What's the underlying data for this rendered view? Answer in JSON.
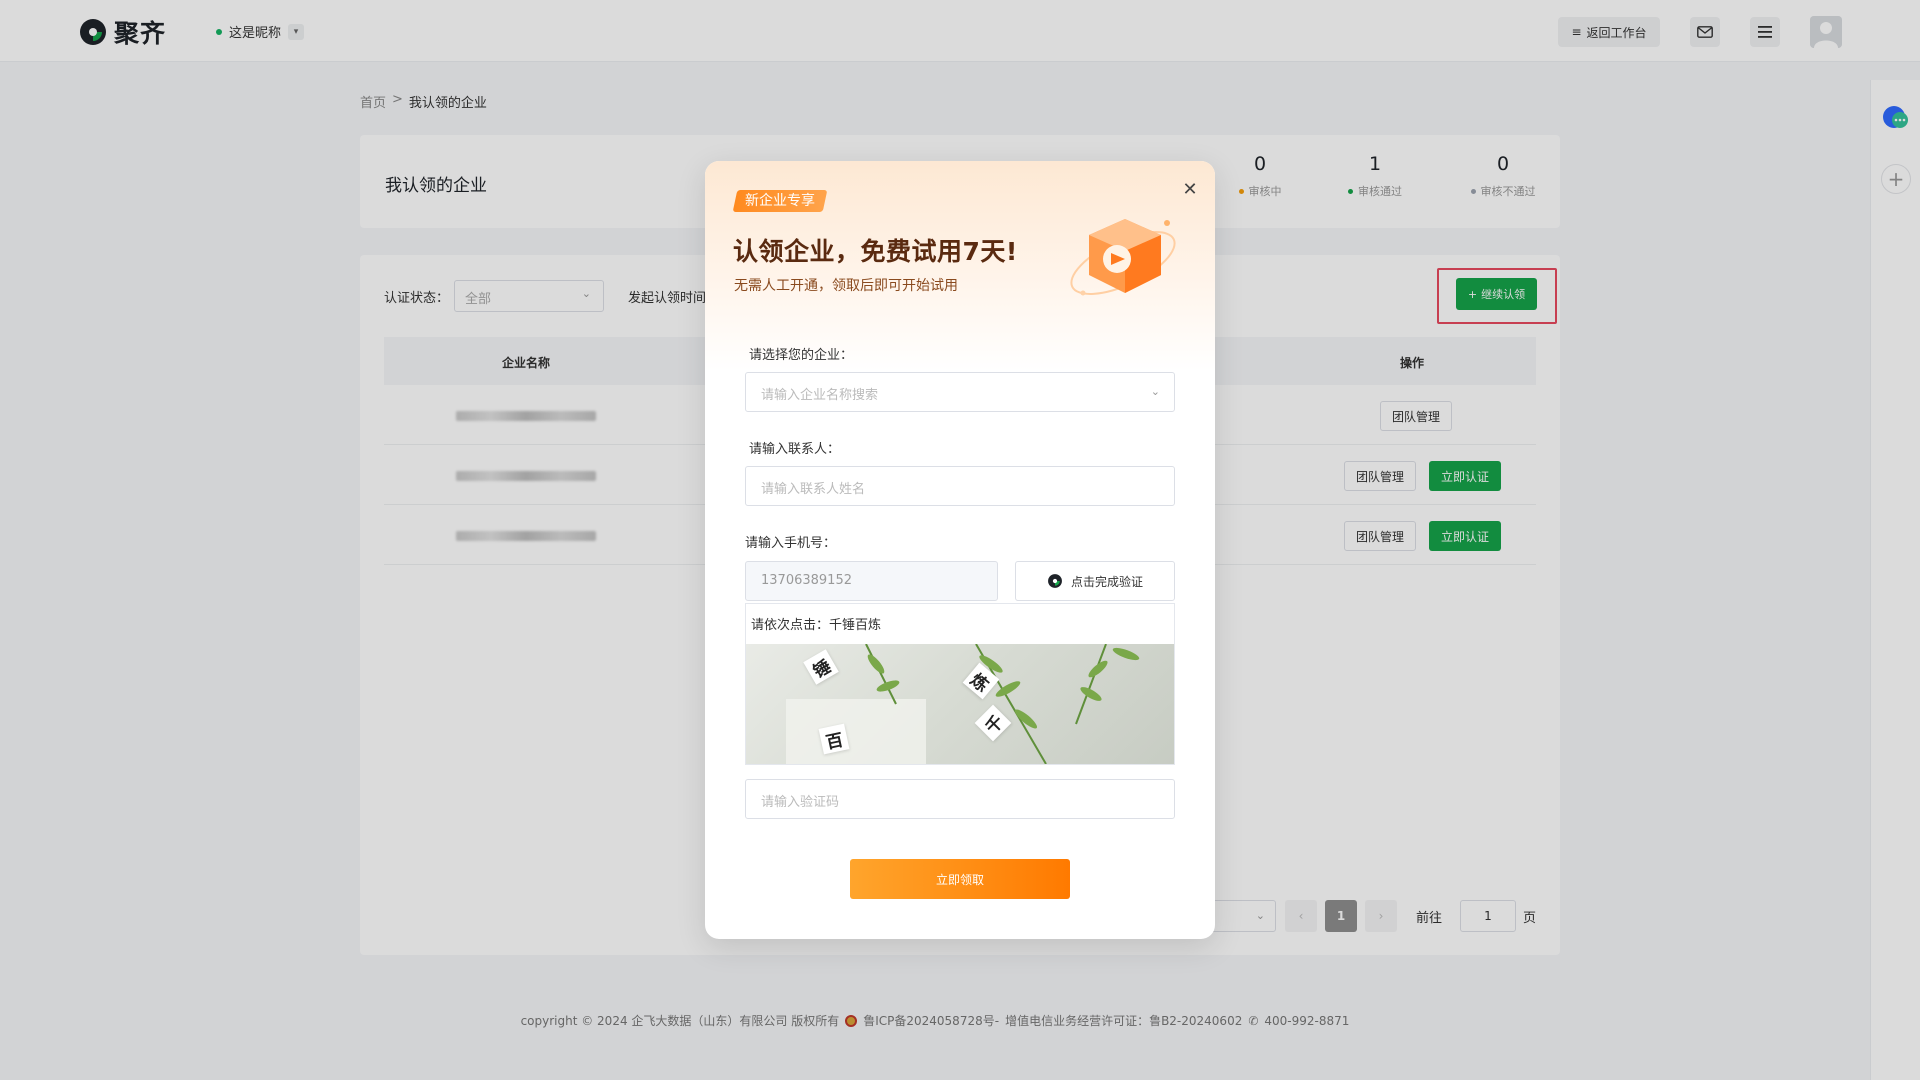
{
  "header": {
    "brand": "聚齐",
    "nickname": "这是昵称",
    "back_label": "返回工作台"
  },
  "breadcrumb": {
    "home": "首页",
    "sep": ">",
    "current": "我认领的企业"
  },
  "summary": {
    "title": "我认领的企业",
    "stats": [
      {
        "value": "0",
        "label": "审核中",
        "color": "#f59e0b"
      },
      {
        "value": "1",
        "label": "审核通过",
        "color": "#16a34a"
      },
      {
        "value": "0",
        "label": "审核不通过",
        "color": "#9ca3af"
      }
    ]
  },
  "filters": {
    "status_label": "认证状态：",
    "status_value": "全部",
    "time_label": "发起认领时间"
  },
  "continue_label": "继续认领",
  "table": {
    "headers": {
      "name": "企业名称",
      "actions": "操作"
    },
    "rows": [
      {
        "manage": "团队管理"
      },
      {
        "manage": "团队管理",
        "verify": "立即认证"
      },
      {
        "manage": "团队管理",
        "verify": "立即认证"
      }
    ]
  },
  "pagination": {
    "current": "1",
    "goto_label": "前往",
    "goto_value": "1",
    "page_suffix": "页",
    "prev": "‹",
    "next": "›"
  },
  "footer": {
    "copyright": "copyright © 2024 企飞大数据（山东）有限公司 版权所有",
    "icp": "鲁ICP备2024058728号-",
    "license": "增值电信业务经营许可证：鲁B2-20240602",
    "phone": "400-992-8871"
  },
  "modal": {
    "badge": "新企业专享",
    "title": "认领企业，免费试用7天!",
    "subtitle": "无需人工开通，领取后即可开始试用",
    "company_label": "请选择您的企业：",
    "company_placeholder": "请输入企业名称搜索",
    "contact_label": "请输入联系人：",
    "contact_placeholder": "请输入联系人姓名",
    "phone_label": "请输入手机号：",
    "phone_value": "13706389152",
    "verify_label": "点击完成验证",
    "captcha_hint": "请依次点击：千锤百炼",
    "captcha_chars": [
      "锤",
      "炼",
      "千",
      "百"
    ],
    "code_placeholder": "请输入验证码",
    "submit_label": "立即领取"
  },
  "colors": {
    "brand_green": "#16a34a",
    "accent_orange": "#ff8a1f",
    "highlight_red": "#e84a5f"
  }
}
